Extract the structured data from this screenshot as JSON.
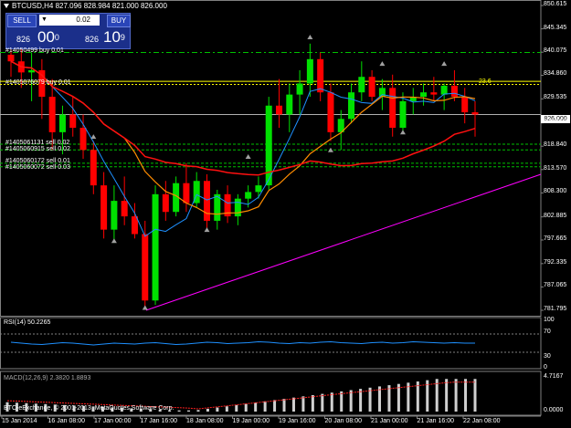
{
  "header": {
    "title": "BTCUSD,H4  827.096 828.984 821.000 826.000"
  },
  "trade_panel": {
    "sell_label": "SELL",
    "buy_label": "BUY",
    "lot_value": "0.02",
    "sell_price_small": "826",
    "sell_price_big": "00",
    "sell_price_sup": "0",
    "buy_price_small": "826",
    "buy_price_big": "10",
    "buy_price_sup": "9"
  },
  "orders": [
    {
      "label": "#14050499 buy 0.01",
      "color": "#00c000"
    },
    {
      "label": "#1405076079 buy 0.01",
      "color": "#ffff00"
    },
    {
      "label": "#1405061131 sell 0.02",
      "color": "#00c000"
    },
    {
      "label": "#1405060915 sell 0.02",
      "color": "#00c000"
    },
    {
      "label": "#1405060172 sell 0.01",
      "color": "#00c000"
    },
    {
      "label": "#1405060072 sell 0.03",
      "color": "#00c000"
    }
  ],
  "fib_label": "23.6",
  "current_price_tag": "826.000",
  "price_axis": [
    "850.615",
    "845.345",
    "840.075",
    "834.860",
    "829.535",
    "824.110",
    "818.840",
    "813.570",
    "808.300",
    "802.885",
    "797.665",
    "792.335",
    "787.065",
    "781.795"
  ],
  "time_axis": [
    "15 Jan 2014",
    "16 Jan 08:00",
    "17 Jan 00:00",
    "17 Jan 16:00",
    "18 Jan 08:00",
    "19 Jan 00:00",
    "19 Jan 16:00",
    "20 Jan 08:00",
    "21 Jan 00:00",
    "21 Jan 16:00",
    "22 Jan 08:00"
  ],
  "rsi": {
    "label": "RSI(14) 50.2265",
    "levels": [
      "100",
      "70",
      "30",
      "0"
    ]
  },
  "macd": {
    "label": "MACD(12,26,9) 2.3820 1.8893",
    "axis_top": "4.7167",
    "axis_bottom": "0.0000"
  },
  "footer": "BTC-eExchange, © 2001-2013, MetaQuotes Software Corp.",
  "colors": {
    "background": "#000000",
    "bull": "#00e000",
    "bear": "#ff0000",
    "ma_fast": "#1e90ff",
    "ma_mid": "#ff8c00",
    "ma_slow": "#ff1010",
    "trendline": "#ff00ff",
    "rsi_line": "#1e90ff"
  },
  "chart_data": {
    "type": "candlestick",
    "symbol": "BTCUSD",
    "timeframe": "H4",
    "ylim": [
      781.795,
      850.615
    ],
    "candles": [
      {
        "o": 839.5,
        "h": 845.0,
        "l": 834.5,
        "c": 838.0
      },
      {
        "o": 838.0,
        "h": 843.0,
        "l": 832.0,
        "c": 835.5
      },
      {
        "o": 835.5,
        "h": 840.0,
        "l": 829.0,
        "c": 836.0
      },
      {
        "o": 836.0,
        "h": 838.5,
        "l": 825.0,
        "c": 830.0
      },
      {
        "o": 830.0,
        "h": 834.0,
        "l": 818.0,
        "c": 822.0
      },
      {
        "o": 822.0,
        "h": 828.0,
        "l": 817.0,
        "c": 826.0
      },
      {
        "o": 826.0,
        "h": 830.0,
        "l": 821.0,
        "c": 823.0
      },
      {
        "o": 823.0,
        "h": 826.0,
        "l": 816.0,
        "c": 818.0
      },
      {
        "o": 818.0,
        "h": 820.0,
        "l": 808.0,
        "c": 810.0
      },
      {
        "o": 810.0,
        "h": 813.0,
        "l": 798.0,
        "c": 800.0
      },
      {
        "o": 800.0,
        "h": 810.0,
        "l": 797.0,
        "c": 806.5
      },
      {
        "o": 806.5,
        "h": 812.0,
        "l": 801.0,
        "c": 803.0
      },
      {
        "o": 803.0,
        "h": 806.0,
        "l": 798.0,
        "c": 799.0
      },
      {
        "o": 799.0,
        "h": 802.0,
        "l": 782.0,
        "c": 784.0
      },
      {
        "o": 784.0,
        "h": 810.0,
        "l": 783.0,
        "c": 808.0
      },
      {
        "o": 808.0,
        "h": 811.0,
        "l": 802.0,
        "c": 804.0
      },
      {
        "o": 804.0,
        "h": 812.0,
        "l": 803.0,
        "c": 810.5
      },
      {
        "o": 810.5,
        "h": 815.0,
        "l": 804.0,
        "c": 806.0
      },
      {
        "o": 806.0,
        "h": 813.0,
        "l": 805.0,
        "c": 811.0
      },
      {
        "o": 811.0,
        "h": 812.5,
        "l": 800.0,
        "c": 802.0
      },
      {
        "o": 802.0,
        "h": 809.0,
        "l": 800.0,
        "c": 808.0
      },
      {
        "o": 808.0,
        "h": 810.0,
        "l": 801.5,
        "c": 803.0
      },
      {
        "o": 803.0,
        "h": 808.0,
        "l": 801.0,
        "c": 807.0
      },
      {
        "o": 807.0,
        "h": 810.0,
        "l": 805.0,
        "c": 808.5
      },
      {
        "o": 808.5,
        "h": 812.0,
        "l": 807.0,
        "c": 810.0
      },
      {
        "o": 810.0,
        "h": 830.0,
        "l": 809.0,
        "c": 828.0
      },
      {
        "o": 828.0,
        "h": 834.0,
        "l": 823.0,
        "c": 826.0
      },
      {
        "o": 826.0,
        "h": 833.0,
        "l": 822.0,
        "c": 830.5
      },
      {
        "o": 830.5,
        "h": 836.0,
        "l": 826.0,
        "c": 833.0
      },
      {
        "o": 833.0,
        "h": 842.0,
        "l": 830.0,
        "c": 838.5
      },
      {
        "o": 838.5,
        "h": 840.0,
        "l": 829.0,
        "c": 831.0
      },
      {
        "o": 831.0,
        "h": 833.0,
        "l": 820.0,
        "c": 822.0
      },
      {
        "o": 822.0,
        "h": 827.0,
        "l": 818.0,
        "c": 825.0
      },
      {
        "o": 825.0,
        "h": 833.0,
        "l": 824.0,
        "c": 831.0
      },
      {
        "o": 831.0,
        "h": 838.0,
        "l": 829.0,
        "c": 834.5
      },
      {
        "o": 834.5,
        "h": 836.0,
        "l": 829.0,
        "c": 830.0
      },
      {
        "o": 830.0,
        "h": 834.0,
        "l": 827.0,
        "c": 832.0
      },
      {
        "o": 832.0,
        "h": 835.0,
        "l": 821.0,
        "c": 823.0
      },
      {
        "o": 823.0,
        "h": 831.0,
        "l": 822.0,
        "c": 829.0
      },
      {
        "o": 829.0,
        "h": 832.0,
        "l": 826.0,
        "c": 830.0
      },
      {
        "o": 830.0,
        "h": 833.0,
        "l": 828.0,
        "c": 831.0
      },
      {
        "o": 831.0,
        "h": 834.5,
        "l": 829.0,
        "c": 830.5
      },
      {
        "o": 830.5,
        "h": 833.0,
        "l": 827.0,
        "c": 832.5
      },
      {
        "o": 832.5,
        "h": 836.0,
        "l": 829.0,
        "c": 830.0
      },
      {
        "o": 830.0,
        "h": 832.0,
        "l": 824.0,
        "c": 826.5
      },
      {
        "o": 826.5,
        "h": 829.0,
        "l": 821.0,
        "c": 826.0
      }
    ]
  }
}
